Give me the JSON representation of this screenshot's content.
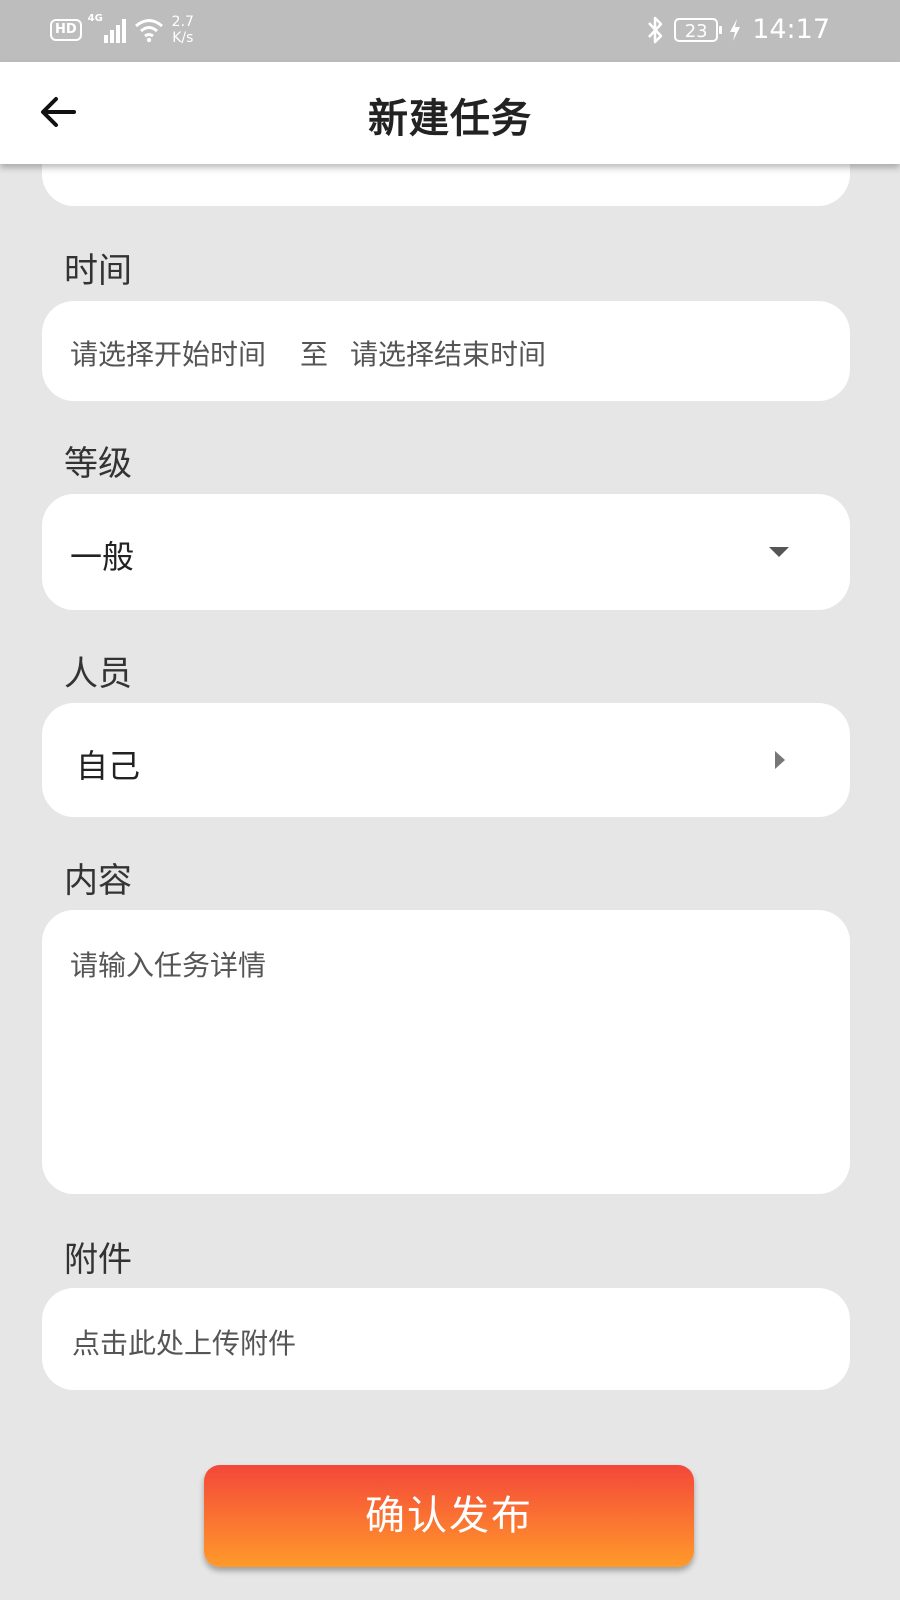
{
  "status_bar": {
    "hd_badge": "HD",
    "network_type": "4G",
    "net_speed_value": "2.7",
    "net_speed_unit": "K/s",
    "battery_level": "23",
    "time": "14:17"
  },
  "header": {
    "title": "新建任务"
  },
  "form": {
    "time": {
      "label": "时间",
      "start_placeholder": "请选择开始时间",
      "separator": "至",
      "end_placeholder": "请选择结束时间"
    },
    "level": {
      "label": "等级",
      "value": "一般"
    },
    "personnel": {
      "label": "人员",
      "value": "自己"
    },
    "content": {
      "label": "内容",
      "placeholder": "请输入任务详情"
    },
    "attachment": {
      "label": "附件",
      "placeholder": "点击此处上传附件"
    }
  },
  "submit": {
    "label": "确认发布"
  },
  "colors": {
    "accent_top": "#f4473a",
    "accent_bottom": "#ff9a2a",
    "background": "#e6e6e6"
  }
}
